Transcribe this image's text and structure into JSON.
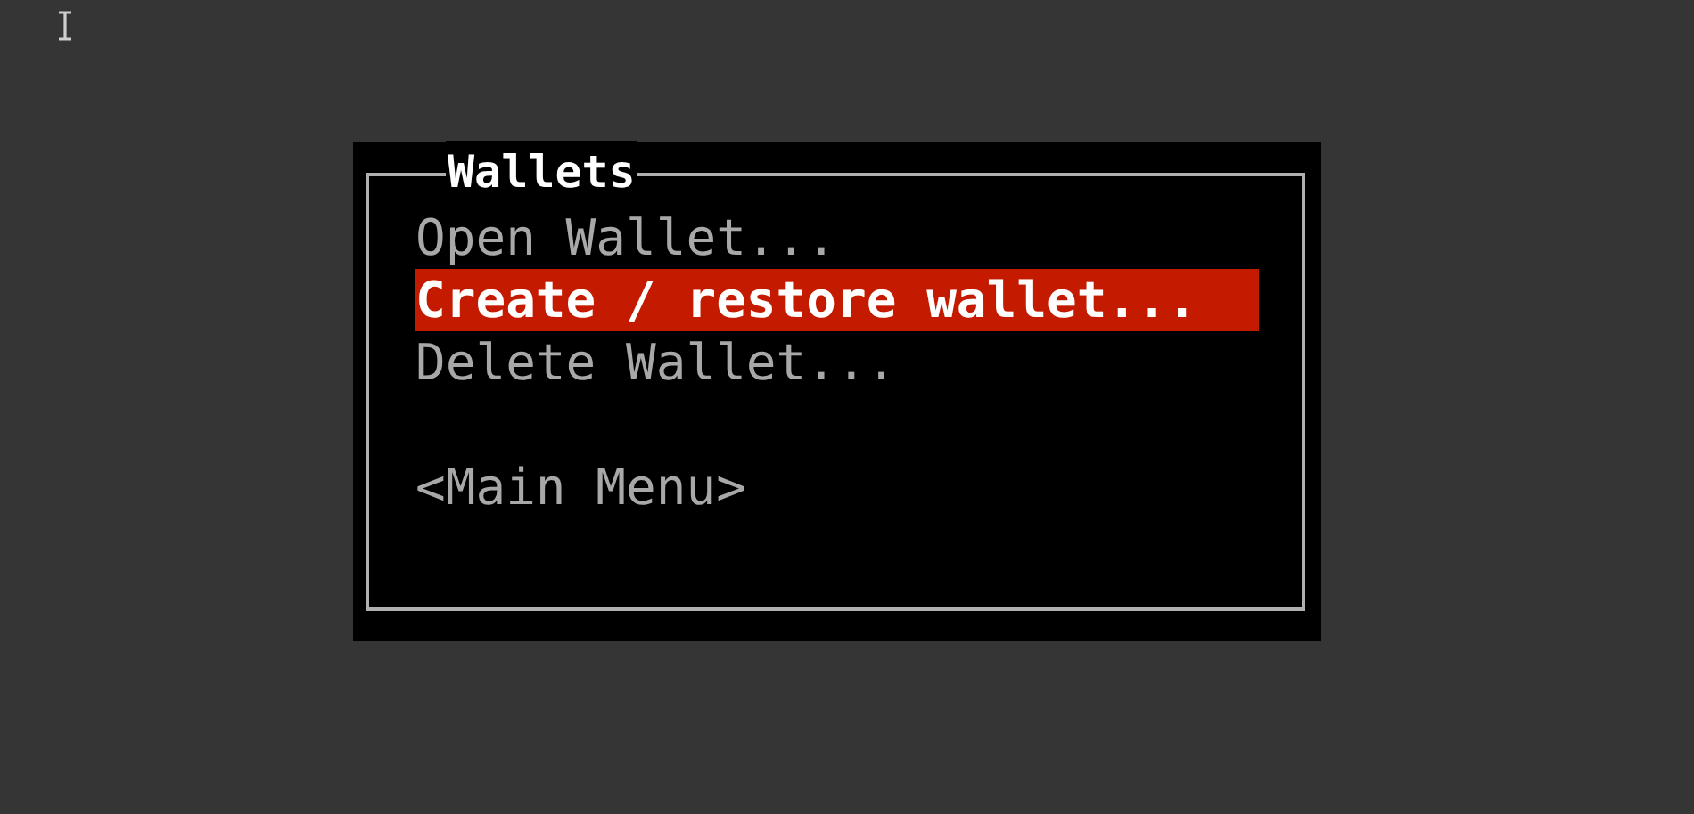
{
  "dialog": {
    "title": "Wallets",
    "items": [
      {
        "label": "Open Wallet...",
        "selected": false
      },
      {
        "label": "Create / restore wallet...",
        "selected": true
      },
      {
        "label": "Delete Wallet...",
        "selected": false
      }
    ],
    "back": {
      "label": "<Main Menu>",
      "selected": false
    }
  }
}
